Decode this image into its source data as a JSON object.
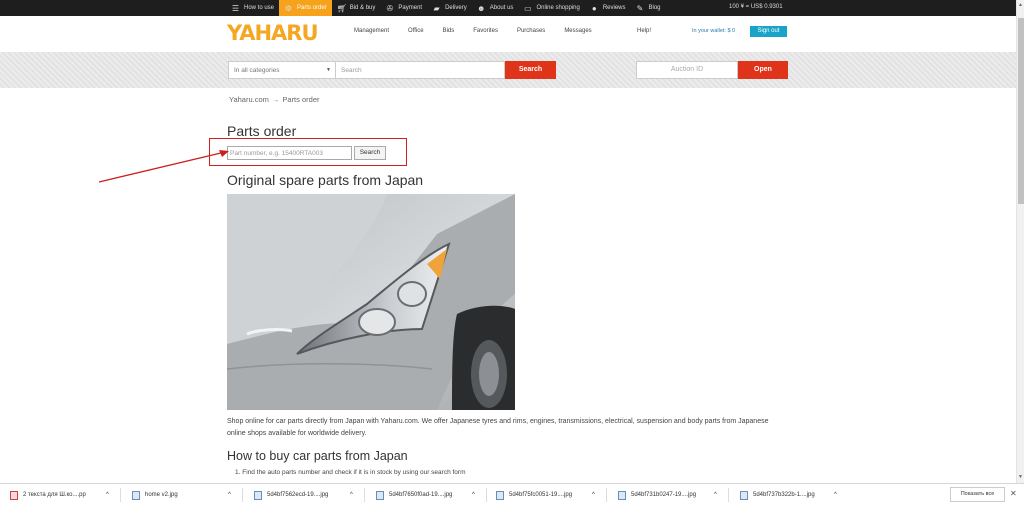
{
  "topbar": {
    "items": [
      {
        "label": "How to use",
        "icon": "menu-icon"
      },
      {
        "label": "Parts order",
        "icon": "gear-icon"
      },
      {
        "label": "Bid & buy",
        "icon": "cart-icon"
      },
      {
        "label": "Payment",
        "icon": "payment-icon"
      },
      {
        "label": "Delivery",
        "icon": "truck-icon"
      },
      {
        "label": "About us",
        "icon": "people-icon"
      },
      {
        "label": "Online shopping",
        "icon": "monitor-icon"
      },
      {
        "label": "Reviews",
        "icon": "chat-icon"
      },
      {
        "label": "Blog",
        "icon": "pen-icon"
      }
    ],
    "active": "Parts order",
    "rate": "100 ¥ = US$ 0.9301"
  },
  "header": {
    "logo": "YAHARU",
    "nav": [
      "Management",
      "Office",
      "Bids",
      "Favorites",
      "Purchases",
      "Messages"
    ],
    "help": "Help!",
    "wallet": "In your wallet: $ 0",
    "signout": "Sign out"
  },
  "search": {
    "category": "In all categories",
    "placeholder": "Search",
    "button": "Search",
    "auction_placeholder": "Auction ID",
    "open_button": "Open"
  },
  "breadcrumb": {
    "home": "Yaharu.com",
    "current": "Parts order"
  },
  "main": {
    "title": "Parts order",
    "part_placeholder": "Part number, e.g. 15400RTA003",
    "part_button": "Search",
    "heading1": "Original spare parts from Japan",
    "paragraph": "Shop online for car parts directly from Japan with Yaharu.com. We offer Japanese tyres and rims, engines, transmissions, electrical, suspension and body parts from Japanese online shops available for worldwide delivery.",
    "heading2": "How to buy car parts from Japan",
    "step1": "1. Find the auto parts number and check if it is in stock by using our search form"
  },
  "downloads": {
    "items": [
      "2 текста для Ш.ко....pp",
      "home v2.jpg",
      "5d4bf7562ecd-19....jpg",
      "5d4bf7650f0ad-19....jpg",
      "5d4bf75fc0051-19....jpg",
      "5d4bf731b0247-19....jpg",
      "5d4bf737b322b-1....jpg"
    ],
    "show_all": "Показать все"
  },
  "colors": {
    "accent": "#f7a21b",
    "button_red": "#e0341a",
    "signout": "#1aa3c8",
    "highlight": "#cc1f1f"
  }
}
